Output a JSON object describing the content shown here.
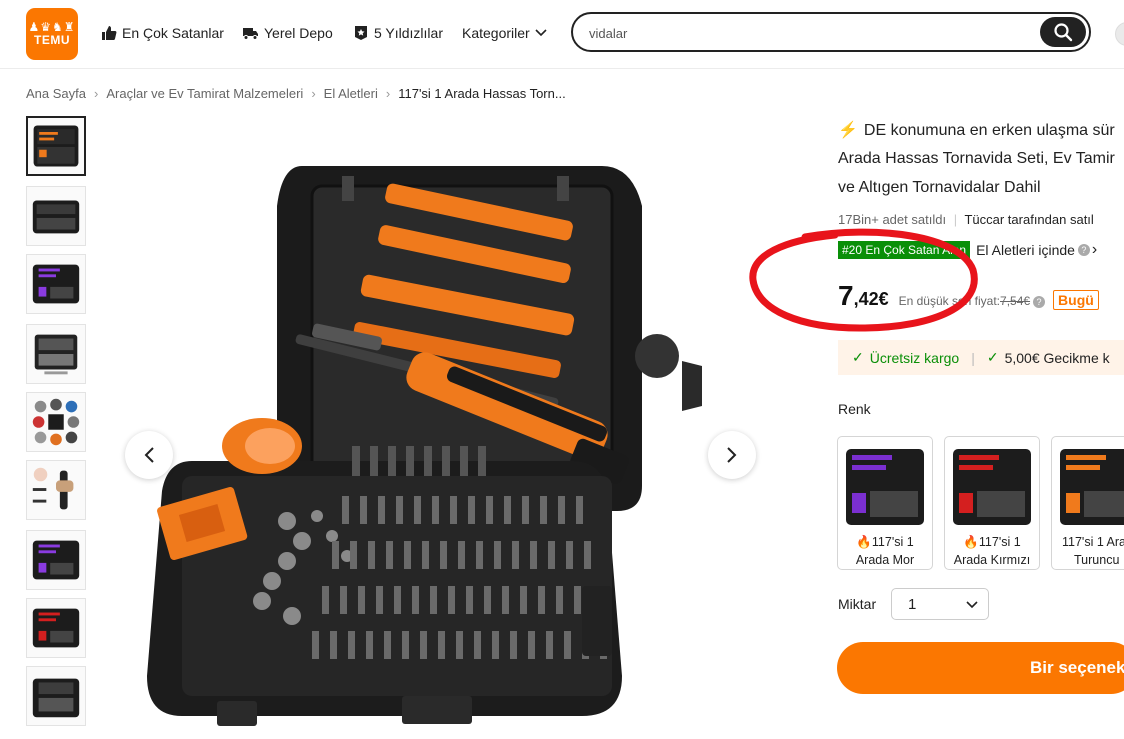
{
  "header": {
    "logo_text": "TEMU",
    "nav": [
      {
        "label": "En Çok Satanlar",
        "icon": "thumbs-up-icon"
      },
      {
        "label": "Yerel Depo",
        "icon": "truck-icon"
      },
      {
        "label": "5 Yıldızlılar",
        "icon": "star-badge-icon"
      },
      {
        "label": "Kategoriler",
        "icon": "chevron-down-icon"
      }
    ],
    "search_value": "vidalar",
    "search_icon": "search-icon"
  },
  "breadcrumb": [
    "Ana Sayfa",
    "Araçlar ve Ev Tamirat Malzemeleri",
    "El Aletleri",
    "117'si 1 Arada Hassas Torn..."
  ],
  "product": {
    "title_line1": "DE konumuna en erken ulaşma sür",
    "title_line2": "Arada Hassas Tornavida Seti, Ev Tamir",
    "title_line3": "ve Altıgen Tornavidalar Dahil",
    "sold": "17Bin+ adet satıldı",
    "seller": "Tüccar tarafından satıl",
    "rank_badge": "#20 En Çok Satan Alan",
    "rank_category": "El Aletleri içinde",
    "price_int": "7",
    "price_dec": ",42€",
    "lowest_label": "En düşük son fiyat:",
    "lowest_price": "7,54€",
    "today_badge": "Bugü",
    "shipping": [
      "Ücretsiz kargo",
      "5,00€ Gecikme k"
    ],
    "color_label": "Renk",
    "swatches": [
      {
        "line1": "117'si 1",
        "line2": "Arada Mor",
        "hot": true,
        "accent": "#7b2fd1"
      },
      {
        "line1": "117'si 1",
        "line2": "Arada Kırmızı",
        "hot": true,
        "accent": "#d41f1f"
      },
      {
        "line1": "117'si 1 Arad",
        "line2": "Turuncu",
        "hot": false,
        "accent": "#f07a1c"
      }
    ],
    "qty_label": "Miktar",
    "qty_value": "1",
    "cta": "Bir seçenek"
  },
  "colors": {
    "brand": "#fb7701",
    "green": "#0a8f08",
    "annotation": "#e8141b"
  }
}
